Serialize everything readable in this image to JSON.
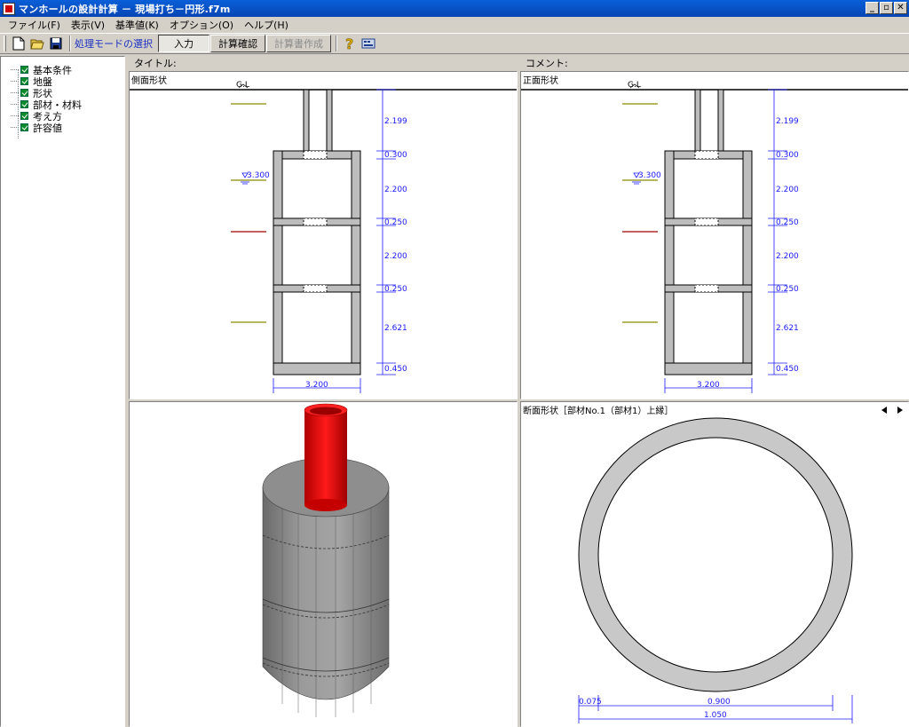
{
  "window": {
    "title": "マンホールの設計計算 － 現場打ち－円形.f7m",
    "buttons": [
      "_",
      "▫",
      "✕"
    ]
  },
  "menu": [
    "ファイル(F)",
    "表示(V)",
    "基準値(K)",
    "オプション(O)",
    "ヘルプ(H)"
  ],
  "toolbar": {
    "mode_label": "処理モードの選択",
    "input_button": "入力",
    "check_button": "計算確認",
    "report_button": "計算書作成"
  },
  "tree": [
    "基本条件",
    "地盤",
    "形状",
    "部材・材料",
    "考え方",
    "許容値"
  ],
  "headers": {
    "title_label": "タイトル:",
    "comment_label": "コメント:"
  },
  "panes": {
    "side_label": "側面形状",
    "front_label": "正面形状",
    "section_label": "断面形状［部材No.1（部材1）上縁］"
  },
  "drawing": {
    "gl": "G.L",
    "water_level": "3.300",
    "heights": [
      "2.199",
      "0.300",
      "2.200",
      "0.250",
      "2.200",
      "0.250",
      "2.621",
      "0.450"
    ],
    "width": "3.200"
  },
  "section": {
    "thickness": "0.075",
    "inner": "0.900",
    "outer": "1.050"
  },
  "colors": {
    "dim": "#1a1aff",
    "pipe3d": "#e00000",
    "body3d": "#8c8c8c"
  }
}
